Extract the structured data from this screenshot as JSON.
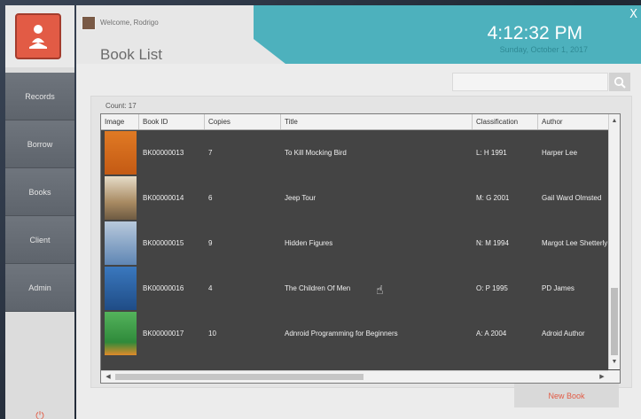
{
  "header": {
    "welcome_text": "Welcome, Rodrigo",
    "time": "4:12:32 PM",
    "date": "Sunday, October 1, 2017",
    "close_label": "X"
  },
  "page": {
    "title": "Book List"
  },
  "sidebar": {
    "items": [
      {
        "label": "Records"
      },
      {
        "label": "Borrow"
      },
      {
        "label": "Books"
      },
      {
        "label": "Client"
      },
      {
        "label": "Admin"
      }
    ]
  },
  "search": {
    "placeholder": "",
    "icon": "search-icon"
  },
  "list": {
    "count_text": "Count: 17",
    "columns": [
      "Image",
      "Book ID",
      "Copies",
      "Title",
      "Classification",
      "Author"
    ],
    "rows": [
      {
        "book_id": "BK00000013",
        "copies": "7",
        "title": "To Kill Mocking Bird",
        "classification": "L: H 1991",
        "author": "Harper Lee",
        "cover_color": "#d9711f"
      },
      {
        "book_id": "BK00000014",
        "copies": "6",
        "title": "Jeep Tour",
        "classification": "M: G 2001",
        "author": "Gail Ward Olmsted",
        "cover_color": "#b49a73"
      },
      {
        "book_id": "BK00000015",
        "copies": "9",
        "title": "Hidden Figures",
        "classification": "N: M 1994",
        "author": "Margot Lee Shetterly",
        "cover_color": "#7a9bbf"
      },
      {
        "book_id": "BK00000016",
        "copies": "4",
        "title": "The Children Of Men",
        "classification": "O: P 1995",
        "author": "PD James",
        "cover_color": "#2f66a6"
      },
      {
        "book_id": "BK00000017",
        "copies": "10",
        "title": "Adnroid Programming for Beginners",
        "classification": "A: A 2004",
        "author": "Adroid Author",
        "cover_color": "#3f9a4a"
      }
    ]
  },
  "actions": {
    "new_book_label": "New Book"
  },
  "colors": {
    "accent": "#e25b45",
    "teal": "#4db1bd",
    "grid_bg": "#444444"
  }
}
